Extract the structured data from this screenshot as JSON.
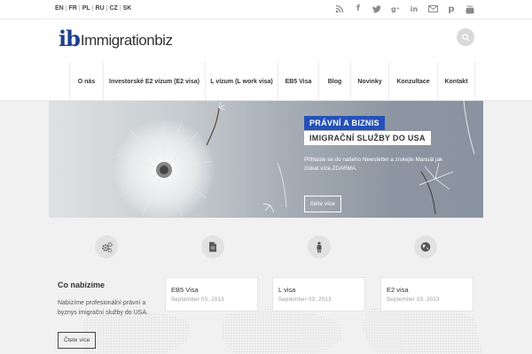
{
  "topbar": {
    "languages": [
      "EN",
      "FR",
      "PL",
      "RU",
      "CZ",
      "SK"
    ],
    "social_icons": [
      "rss-icon",
      "facebook-icon",
      "twitter-icon",
      "google-plus-icon",
      "linkedin-icon",
      "email-icon",
      "pinterest-icon",
      "youtube-icon"
    ]
  },
  "header": {
    "logo_mark": "ib",
    "logo_text": "Immigrationbiz",
    "search_icon": "search-icon"
  },
  "nav": {
    "items": [
      "O nás",
      "Investorské E2 vízum (E2 visa)",
      "L vízum (L work visa)",
      "EB5 Visa",
      "Blog",
      "Novinky",
      "Konzultace",
      "Kontakt"
    ]
  },
  "hero": {
    "badge_primary": "PRÁVNÍ A BIZNIS",
    "badge_secondary": "IMIGRAČNÍ SLUŽBY DO USA",
    "description": "Přihlaste se do našeho Newsletter a získejte Manuál jak získat víza ZDARMA.",
    "button": "čtěte více"
  },
  "features": {
    "icons": [
      "gears-icon",
      "document-icon",
      "person-icon",
      "globe-icon"
    ]
  },
  "offer": {
    "title": "Co nabízíme",
    "text": "Nabízíme profesionální právní a byznys imigrační služby do USA.",
    "button": "Čtete více"
  },
  "posts": [
    {
      "title": "EB5 Visa",
      "date": "September 03, 2013"
    },
    {
      "title": "L visa",
      "date": "September 03, 2013"
    },
    {
      "title": "E2 visa",
      "date": "September 03, 2013"
    }
  ],
  "colors": {
    "accent_blue": "#2551b8",
    "logo_blue": "#1d3f8f",
    "page_bg": "#f1f1f1"
  }
}
